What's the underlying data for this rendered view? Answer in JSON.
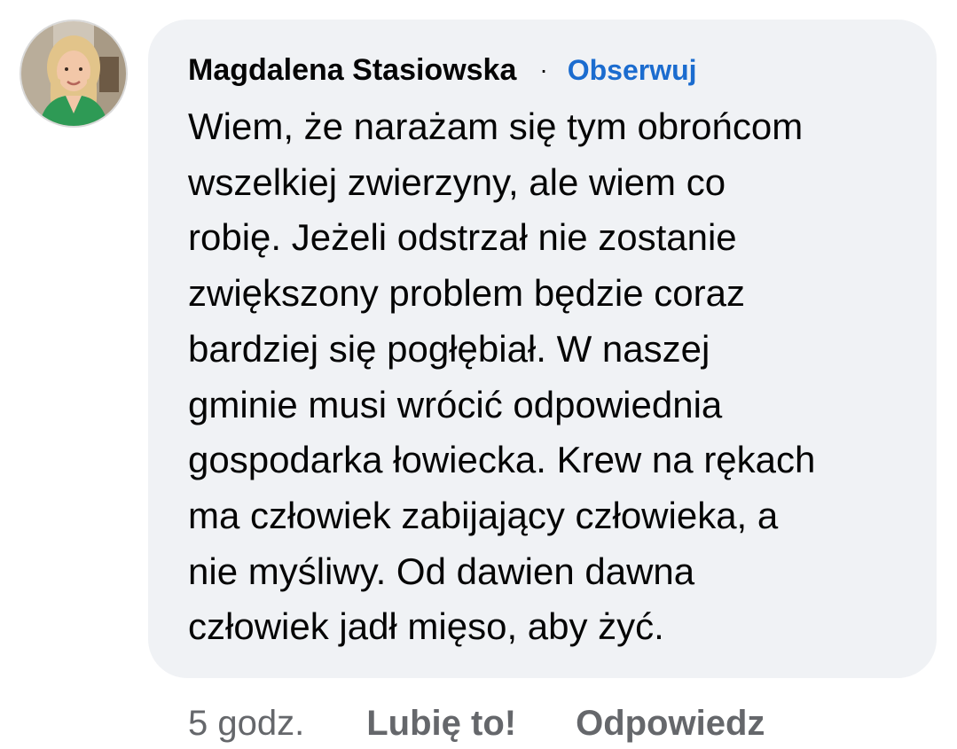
{
  "comment": {
    "author": "Magdalena Stasiowska",
    "separator": "·",
    "follow_label": "Obserwuj",
    "text": "Wiem, że narażam się tym obrońcom\nwszelkiej zwierzyny, ale wiem co\nrobię. Jeżeli odstrzał nie zostanie\nzwiększony problem będzie coraz\nbardziej się pogłębiał. W naszej\ngminie musi wrócić odpowiednia\ngospodarka łowiecka. Krew na rękach\nma człowiek zabijający człowieka, a\nnie myśliwy. Od dawien dawna\nczłowiek jadł mięso, aby żyć.",
    "avatar_icon": "profile-photo-avatar"
  },
  "actions": {
    "time": "5 godz.",
    "like_label": "Lubię to!",
    "reply_label": "Odpowiedz"
  },
  "colors": {
    "bubble_background": "#f0f2f5",
    "link_blue": "#1b6ccf",
    "secondary_text": "#65676b",
    "primary_text": "#050505"
  }
}
